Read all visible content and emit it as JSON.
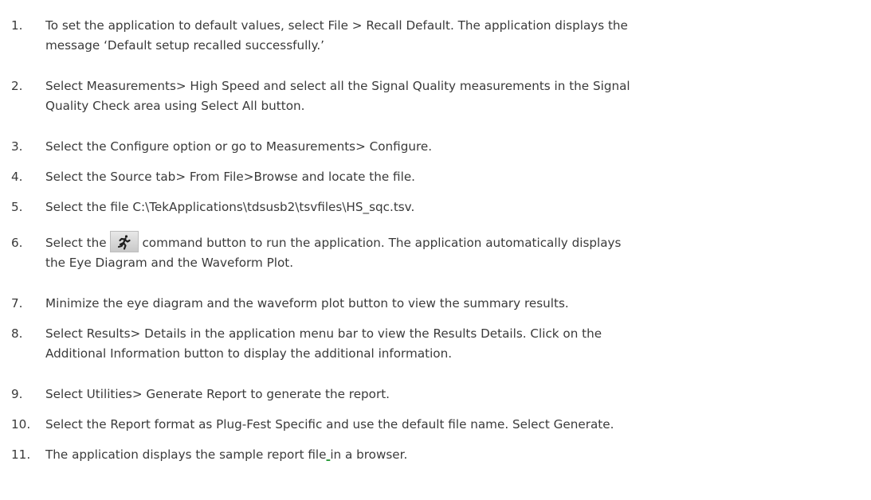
{
  "steps": [
    {
      "number": "1.",
      "line1": "To set the application to default values, select File > Recall Default. The application displays the",
      "line2": "message ‘Default setup recalled successfully.’"
    },
    {
      "number": "2.",
      "line1": "Select Measurements> High Speed and select all the Signal Quality measurements in the Signal",
      "line2": "Quality Check area using Select All button."
    },
    {
      "number": "3.",
      "line1": "Select the Configure option or go to Measurements> Configure."
    },
    {
      "number": "4.",
      "line1": "Select the Source tab> From File>Browse and locate the file."
    },
    {
      "number": "5.",
      "line1": "Select the file C:\\TekApplications\\tdsusb2\\tsvfiles\\HS_sqc.tsv."
    },
    {
      "number": "6.",
      "line1_before": "Select the ",
      "icon": "run-icon",
      "line1_after": "command button to run the application. The application automatically displays",
      "line2": "the Eye Diagram and the Waveform Plot."
    },
    {
      "number": "7.",
      "line1": "Minimize the eye diagram and the waveform plot button to view the summary results."
    },
    {
      "number": "8.",
      "line1": "Select Results> Details in the application menu bar to view the Results Details. Click on the",
      "line2": "Additional Information button to display the additional information."
    },
    {
      "number": "9.",
      "line1": "Select Utilities> Generate Report to generate the report."
    },
    {
      "number": "10.",
      "line1": "Select the Report format as Plug-Fest Specific and use the default file name. Select Generate."
    },
    {
      "number": "11.",
      "line1_before": "The application displays the sample report file",
      "line1_underlined": " ",
      "line1_after": "in a browser."
    }
  ]
}
